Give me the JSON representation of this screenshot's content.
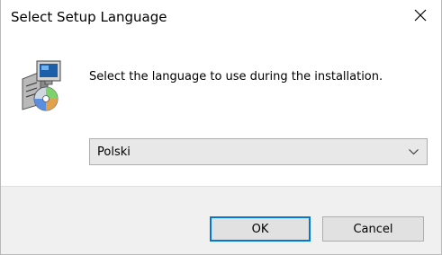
{
  "dialog": {
    "title": "Select Setup Language",
    "close_icon": "close-icon",
    "setup_icon": "setup-package-icon",
    "message": "Select the language to use during the installation.",
    "language_select": {
      "selected": "Polski",
      "arrow_icon": "chevron-down-icon"
    },
    "buttons": {
      "ok_label": "OK",
      "cancel_label": "Cancel"
    }
  },
  "colors": {
    "accent": "#0078d7",
    "footer_bg": "#f0f0f0",
    "select_bg": "#e8e8e8",
    "button_bg": "#e1e1e1"
  }
}
